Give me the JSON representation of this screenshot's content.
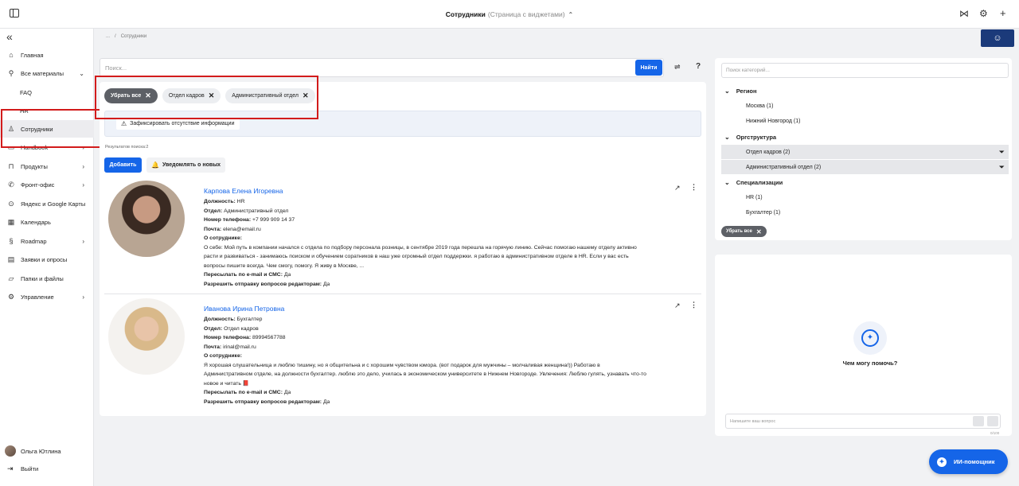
{
  "header": {
    "title": "Сотрудники",
    "subtitle": "(Страница с виджетами)",
    "icons": [
      "panel-toggle-icon",
      "chevron-up-icon",
      "bowtie-icon",
      "gear-icon",
      "plus-icon"
    ]
  },
  "sidebar": {
    "items": [
      {
        "label": "Главная",
        "icon": "home-icon"
      },
      {
        "label": "Все материалы",
        "icon": "search-icon"
      },
      {
        "label": "FAQ",
        "icon": ""
      },
      {
        "label": "HR",
        "icon": ""
      },
      {
        "label": "Сотрудники",
        "icon": "user-icon"
      },
      {
        "label": "Handbook",
        "icon": "book-icon"
      },
      {
        "label": "Продукты",
        "icon": "bag-icon"
      },
      {
        "label": "Фронт-офис",
        "icon": "phone-icon"
      },
      {
        "label": "Яндекс и Google Карты",
        "icon": "pin-icon"
      },
      {
        "label": "Календарь",
        "icon": "calendar-icon"
      },
      {
        "label": "Roadmap",
        "icon": "route-icon"
      },
      {
        "label": "Заявки и опросы",
        "icon": "clipboard-icon"
      },
      {
        "label": "Папки и файлы",
        "icon": "folder-icon"
      },
      {
        "label": "Управление",
        "icon": "gear-icon"
      }
    ],
    "user_name": "Ольга Ютлина",
    "logout_label": "Выйти"
  },
  "breadcrumb": {
    "ellipsis": "...",
    "separator": "/",
    "current": "Сотрудники"
  },
  "search": {
    "placeholder": "Поиск...",
    "button_label": "Найти",
    "help_label": "?"
  },
  "chips": {
    "clear_all": "Убрать все",
    "hr_dept": "Отдел кадров",
    "admin_dept": "Административный отдел"
  },
  "notice": {
    "button_label": "Зафиксировать отсутствие информации"
  },
  "results_label": "Результатов поиска:2",
  "actions": {
    "add_label": "Добавить",
    "notify_label": "Уведомлять о новых"
  },
  "labels": {
    "position": "Должность:",
    "department": "Отдел:",
    "phone": "Номер телефона:",
    "email": "Почта:",
    "about": "О сотруднике:",
    "forward": "Пересылать по e-mail и СМС:",
    "allow_questions": "Разрешить отправку вопросов редакторам:"
  },
  "employees": [
    {
      "name": "Карпова Елена Игоревна",
      "position": "HR",
      "department": "Административный отдел",
      "phone": "+7 999 909 14 37",
      "email": "elena@email.ru",
      "bio": "О себе: Мой путь в компании начался с  отдела по подбору персонала розницы, в сентябре 2019 года перешла на горячую линию. Сейчас помогаю нашему отделу активно расти и развиваться - занимаюсь поиском и обучением соратников в наш уже огромный отдел поддержки. я работаю в административном отделе в HR. Если у вас есть вопросы пишите всегда. Чем смогу,  помогу. Я живу в Москве, ...",
      "forward": "Да",
      "allow_questions": "Да"
    },
    {
      "name": "Иванова Ирина Петровна",
      "position": "Бухгалтер",
      "department": "Отдел кадров",
      "phone": "89994567788",
      "email": "irinal@mail.ru",
      "bio": "Я хорошая слушательница и люблю тишину, но я общительна и с хорошим чувством юмора. (вот подарок для мужчины – молчаливая женщина!)) Работаю в Административном отделе, на должности бухгалтер. люблю это дело, училась в экономическом университете в Нижнем Новгороде.  Увлечения: Люблю гулять, узнавать что-то новое и читать 📕",
      "forward": "Да",
      "allow_questions": "Да"
    }
  ],
  "categories": {
    "placeholder": "Поиск категорий...",
    "groups": [
      {
        "title": "Регион",
        "items": [
          "Москва (1)",
          "Нижний Новгород (1)"
        ]
      },
      {
        "title": "Оргструктура",
        "items": [
          "Отдел кадров (2)",
          "Административный отдел (2)"
        ]
      },
      {
        "title": "Специализации",
        "items": [
          "HR (1)",
          "Бухгалтер (1)"
        ]
      }
    ],
    "clear_all": "Убрать все"
  },
  "assistant": {
    "prompt": "Чем могу помочь?",
    "input_placeholder": "Напишите ваш вопрос",
    "counter": "0/100",
    "fab_label": "ИИ-помощник"
  },
  "colors": {
    "accent": "#1565e8",
    "highlight": "#d21b1b",
    "chip_dark": "#5d6066"
  }
}
